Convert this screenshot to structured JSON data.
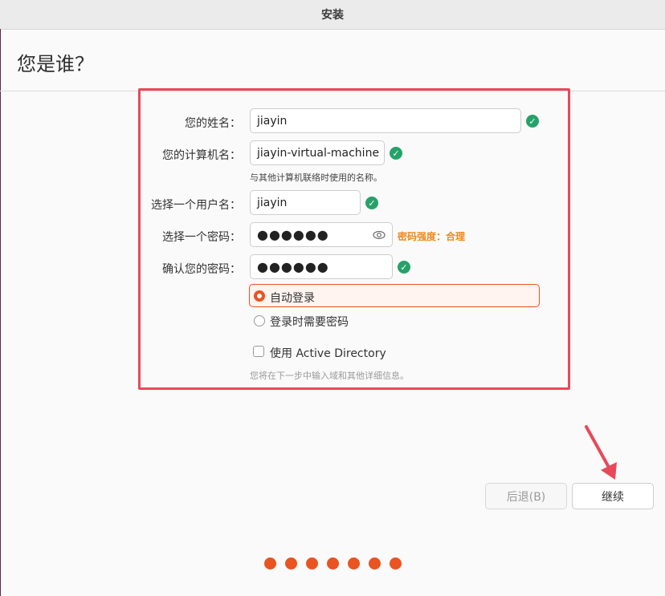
{
  "window": {
    "title": "安装"
  },
  "page": {
    "heading": "您是谁？"
  },
  "form": {
    "name": {
      "label": "您的姓名：",
      "value": "jiayin",
      "valid": true
    },
    "computer": {
      "label": "您的计算机名：",
      "value": "jiayin-virtual-machine",
      "hint": "与其他计算机联络时使用的名称。",
      "valid": true
    },
    "username": {
      "label": "选择一个用户名：",
      "value": "jiayin",
      "valid": true
    },
    "password": {
      "label": "选择一个密码：",
      "value": "●●●●●●",
      "strength": "密码强度：合理"
    },
    "confirm": {
      "label": "确认您的密码：",
      "value": "●●●●●●",
      "valid": true
    },
    "login_options": [
      {
        "label": "自动登录",
        "selected": true
      },
      {
        "label": "登录时需要密码",
        "selected": false
      }
    ],
    "active_directory": {
      "label": "使用 Active Directory",
      "checked": false,
      "note": "您将在下一步中输入域和其他详细信息。"
    }
  },
  "buttons": {
    "back": "后退(B)",
    "continue": "继续"
  },
  "progress": {
    "total": 7,
    "done": 7
  },
  "colors": {
    "accent": "#e95420",
    "success": "#26a269",
    "highlight": "#e8495a",
    "strength": "#f0881b"
  }
}
